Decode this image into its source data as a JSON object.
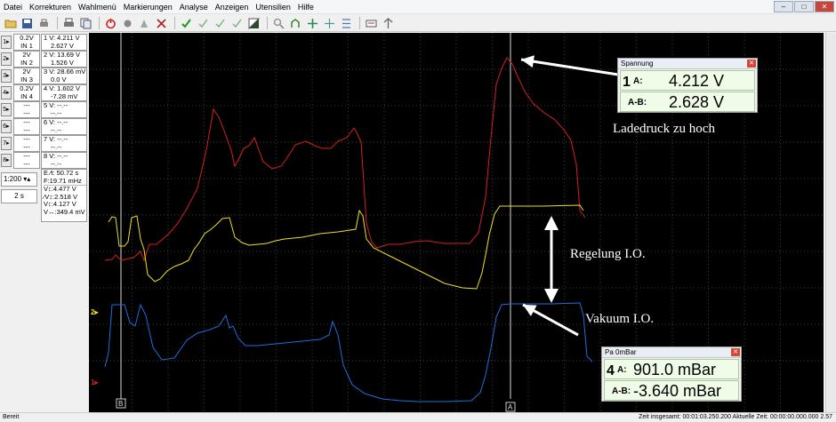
{
  "menu": [
    "Datei",
    "Korrekturen",
    "Wahlmenü",
    "Markierungen",
    "Analyse",
    "Anzeigen",
    "Utensilien",
    "Hilfe"
  ],
  "window_buttons": [
    "–",
    "□",
    "✕"
  ],
  "toolbar_icons": [
    "folder-icon",
    "save-icon",
    "print-setup-icon",
    "print-icon",
    "copy-icon",
    "power-icon",
    "record-icon",
    "scale-icon",
    "cut-icon",
    "check-icon",
    "measure-icon",
    "cursor-icon",
    "colour-icon",
    "loupe-icon",
    "filter-icon",
    "arrow-icon",
    "crosshair-icon",
    "bracket-icon",
    "math-icon",
    "settings-icon",
    "pin-icon"
  ],
  "channels": [
    {
      "btn": "1▸",
      "range": "0.2V",
      "input": "IN 1",
      "read_label": "1",
      "a_label": "V:",
      "a": "4.211 V",
      "b_label": "▼⁄: ",
      "b": "2.627 V"
    },
    {
      "btn": "2▸",
      "range": "2V",
      "input": "IN 2",
      "read_label": "2",
      "a_label": "V:",
      "a": "13.69 V",
      "b_label": "⁄: ",
      "b": "1.526 V"
    },
    {
      "btn": "3▸",
      "range": "2V",
      "input": "IN 3",
      "read_label": "3",
      "a_label": "V:",
      "a": "28.66 mV",
      "b_label": "⁄: ",
      "b": "0.0 V"
    },
    {
      "btn": "4▸",
      "range": "0.2V",
      "input": "IN 4",
      "read_label": "4",
      "a_label": "V:",
      "a": "1.602 V",
      "b_label": "⁄: ",
      "b": "-7.28 mV"
    }
  ],
  "empty_channels": [
    {
      "btn": "5▸",
      "range": "---",
      "input": "---",
      "read_label": "5",
      "a": "--.--",
      "b": "--.--"
    },
    {
      "btn": "6▸",
      "range": "---",
      "input": "---",
      "read_label": "6",
      "a": "--.--",
      "b": "--.--"
    },
    {
      "btn": "7▸",
      "range": "---",
      "input": "---",
      "read_label": "7",
      "a": "--.--",
      "b": "--.--"
    },
    {
      "btn": "8▸",
      "range": "---",
      "input": "---",
      "read_label": "8",
      "a": "--.--",
      "b": "--.--"
    }
  ],
  "timebase": {
    "ratio": "1:200",
    "div": "2 s"
  },
  "cursor_info": {
    "e": "E ⁄t: 50.72 s",
    "f": "F:19.71 mHz",
    "v1": "V↕:4.477 V",
    "v2": "⁄V↕:2.518 V",
    "v3": "V↕:4.127 V",
    "v4": "V↔:349.4 mV"
  },
  "markers": {
    "ch2": "2▸",
    "ch1": "1▸",
    "cursor_b": "B",
    "cursor_a": "A"
  },
  "meas_voltage": {
    "title": "Spannung",
    "ch": "1",
    "a_label": "A:",
    "a_value": "4.212 V",
    "ab_label": "A-B:",
    "ab_value": "2.628 V"
  },
  "meas_pressure": {
    "title": "Pa 0mBar",
    "ch": "4",
    "a_label": "A:",
    "a_value": "901.0 mBar",
    "ab_label": "A-B:",
    "ab_value": "-3.640 mBar"
  },
  "annotations": {
    "boost": "Ladedruck zu hoch",
    "regulation": "Regelung I.O.",
    "vacuum": "Vakuum I.O."
  },
  "status": {
    "left": "Bereit",
    "right": "Zeit insgesamt: 00:01:03.250.200   Aktuelle Zeit: 00:00:00.000.000   2.57"
  },
  "colors": {
    "ch1": "#d4201e",
    "ch2": "#f0e020",
    "ch4": "#1e6ee0",
    "grid": "#555555",
    "background": "#000000"
  }
}
